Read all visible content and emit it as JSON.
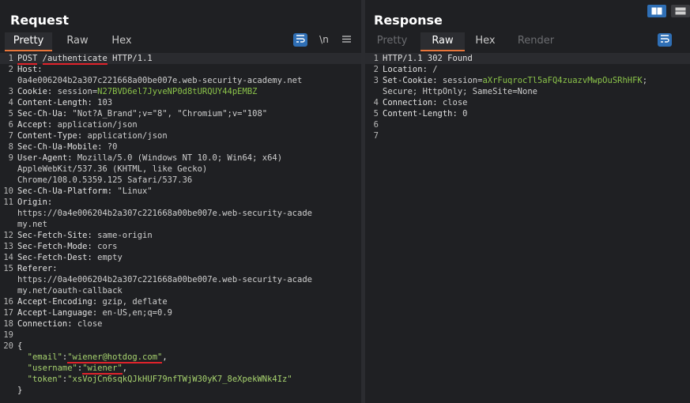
{
  "request": {
    "title": "Request",
    "tabs": [
      "Pretty",
      "Raw",
      "Hex"
    ],
    "active_tab": "Pretty",
    "tools": {
      "newline_toggle": "\\n",
      "menu": "≡"
    },
    "lines": [
      {
        "n": "1",
        "segs": [
          {
            "t": "POST",
            "c": "k",
            "u": true
          },
          {
            "t": " ",
            "c": "k"
          },
          {
            "t": "/authenticate",
            "c": "k",
            "u": true
          },
          {
            "t": " HTTP/1.1",
            "c": "k"
          }
        ]
      },
      {
        "n": "2",
        "segs": [
          {
            "t": "Host:",
            "c": "k"
          }
        ]
      },
      {
        "n": "",
        "segs": [
          {
            "t": "0a4e006204b2a307c221668a00be007e.web-security-academy.net",
            "c": "v"
          }
        ]
      },
      {
        "n": "3",
        "segs": [
          {
            "t": "Cookie: ",
            "c": "k"
          },
          {
            "t": "session",
            "c": "v"
          },
          {
            "t": "=",
            "c": "v"
          },
          {
            "t": "N27BVD6el7JyveNP0d8tURQUY44pEMBZ",
            "c": "g"
          }
        ]
      },
      {
        "n": "4",
        "segs": [
          {
            "t": "Content-Length: ",
            "c": "k"
          },
          {
            "t": "103",
            "c": "v"
          }
        ]
      },
      {
        "n": "5",
        "segs": [
          {
            "t": "Sec-Ch-Ua: ",
            "c": "k"
          },
          {
            "t": "\"Not?A_Brand\";v=\"8\", \"Chromium\";v=\"108\"",
            "c": "v"
          }
        ]
      },
      {
        "n": "6",
        "segs": [
          {
            "t": "Accept: ",
            "c": "k"
          },
          {
            "t": "application/json",
            "c": "v"
          }
        ]
      },
      {
        "n": "7",
        "segs": [
          {
            "t": "Content-Type: ",
            "c": "k"
          },
          {
            "t": "application/json",
            "c": "v"
          }
        ]
      },
      {
        "n": "8",
        "segs": [
          {
            "t": "Sec-Ch-Ua-Mobile: ",
            "c": "k"
          },
          {
            "t": "?0",
            "c": "v"
          }
        ]
      },
      {
        "n": "9",
        "segs": [
          {
            "t": "User-Agent: ",
            "c": "k"
          },
          {
            "t": "Mozilla/5.0 (Windows NT 10.0; Win64; x64)",
            "c": "v"
          }
        ]
      },
      {
        "n": "",
        "segs": [
          {
            "t": "AppleWebKit/537.36 (KHTML, like Gecko)",
            "c": "v"
          }
        ]
      },
      {
        "n": "",
        "segs": [
          {
            "t": "Chrome/108.0.5359.125 Safari/537.36",
            "c": "v"
          }
        ]
      },
      {
        "n": "10",
        "segs": [
          {
            "t": "Sec-Ch-Ua-Platform: ",
            "c": "k"
          },
          {
            "t": "\"Linux\"",
            "c": "v"
          }
        ]
      },
      {
        "n": "11",
        "segs": [
          {
            "t": "Origin:",
            "c": "k"
          }
        ]
      },
      {
        "n": "",
        "segs": [
          {
            "t": "https://0a4e006204b2a307c221668a00be007e.web-security-acade",
            "c": "v"
          }
        ]
      },
      {
        "n": "",
        "segs": [
          {
            "t": "my.net",
            "c": "v"
          }
        ]
      },
      {
        "n": "12",
        "segs": [
          {
            "t": "Sec-Fetch-Site: ",
            "c": "k"
          },
          {
            "t": "same-origin",
            "c": "v"
          }
        ]
      },
      {
        "n": "13",
        "segs": [
          {
            "t": "Sec-Fetch-Mode: ",
            "c": "k"
          },
          {
            "t": "cors",
            "c": "v"
          }
        ]
      },
      {
        "n": "14",
        "segs": [
          {
            "t": "Sec-Fetch-Dest: ",
            "c": "k"
          },
          {
            "t": "empty",
            "c": "v"
          }
        ]
      },
      {
        "n": "15",
        "segs": [
          {
            "t": "Referer:",
            "c": "k"
          }
        ]
      },
      {
        "n": "",
        "segs": [
          {
            "t": "https://0a4e006204b2a307c221668a00be007e.web-security-acade",
            "c": "v"
          }
        ]
      },
      {
        "n": "",
        "segs": [
          {
            "t": "my.net/oauth-callback",
            "c": "v"
          }
        ]
      },
      {
        "n": "16",
        "segs": [
          {
            "t": "Accept-Encoding: ",
            "c": "k"
          },
          {
            "t": "gzip, deflate",
            "c": "v"
          }
        ]
      },
      {
        "n": "17",
        "segs": [
          {
            "t": "Accept-Language: ",
            "c": "k"
          },
          {
            "t": "en-US,en;q=0.9",
            "c": "v"
          }
        ]
      },
      {
        "n": "18",
        "segs": [
          {
            "t": "Connection: ",
            "c": "k"
          },
          {
            "t": "close",
            "c": "v"
          }
        ]
      },
      {
        "n": "19",
        "segs": []
      },
      {
        "n": "20",
        "segs": [
          {
            "t": "{",
            "c": "k"
          }
        ]
      },
      {
        "n": "",
        "segs": [
          {
            "t": "  \"email\"",
            "c": "sval"
          },
          {
            "t": ":",
            "c": "k"
          },
          {
            "t": "\"wiener@hotdog.com\"",
            "c": "sval",
            "u": true
          },
          {
            "t": ",",
            "c": "k"
          }
        ]
      },
      {
        "n": "",
        "segs": [
          {
            "t": "  \"username\"",
            "c": "sval"
          },
          {
            "t": ":",
            "c": "k"
          },
          {
            "t": "\"wiener\"",
            "c": "sval",
            "u": true
          },
          {
            "t": ",",
            "c": "k"
          }
        ]
      },
      {
        "n": "",
        "segs": [
          {
            "t": "  \"token\"",
            "c": "sval"
          },
          {
            "t": ":",
            "c": "k"
          },
          {
            "t": "\"xsVojCn6sqkQJkHUF79nfTWjW30yK7_8eXpekWNk4Iz\"",
            "c": "sval"
          }
        ]
      },
      {
        "n": "",
        "segs": [
          {
            "t": "}",
            "c": "k"
          }
        ]
      }
    ]
  },
  "response": {
    "title": "Response",
    "tabs": [
      "Pretty",
      "Raw",
      "Hex",
      "Render"
    ],
    "active_tab": "Raw",
    "lines": [
      {
        "n": "1",
        "segs": [
          {
            "t": "HTTP/1.1 302 Found",
            "c": "k"
          }
        ]
      },
      {
        "n": "2",
        "segs": [
          {
            "t": "Location: ",
            "c": "k"
          },
          {
            "t": "/",
            "c": "v"
          }
        ]
      },
      {
        "n": "3",
        "segs": [
          {
            "t": "Set-Cookie: ",
            "c": "k"
          },
          {
            "t": "session",
            "c": "v"
          },
          {
            "t": "=",
            "c": "v"
          },
          {
            "t": "aXrFuqrocTl5aFQ4zuazvMwpOuSRhHFK",
            "c": "g"
          },
          {
            "t": ";",
            "c": "v"
          }
        ]
      },
      {
        "n": "",
        "segs": [
          {
            "t": "Secure; HttpOnly; SameSite=None",
            "c": "v"
          }
        ]
      },
      {
        "n": "4",
        "segs": [
          {
            "t": "Connection: ",
            "c": "k"
          },
          {
            "t": "close",
            "c": "v"
          }
        ]
      },
      {
        "n": "5",
        "segs": [
          {
            "t": "Content-Length: ",
            "c": "k"
          },
          {
            "t": "0",
            "c": "v"
          }
        ]
      },
      {
        "n": "6",
        "segs": []
      },
      {
        "n": "7",
        "segs": []
      }
    ]
  }
}
